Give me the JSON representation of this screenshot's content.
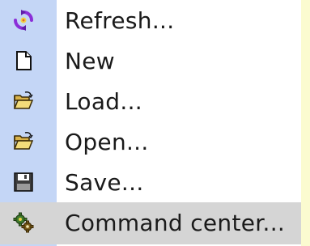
{
  "menu": {
    "items": [
      {
        "label": "Refresh...",
        "icon": "refresh-icon"
      },
      {
        "label": "New",
        "icon": "new-document-icon"
      },
      {
        "label": "Load...",
        "icon": "open-folder-icon"
      },
      {
        "label": "Open...",
        "icon": "open-folder-icon"
      },
      {
        "label": "Save...",
        "icon": "floppy-disk-icon"
      },
      {
        "label": "Command center...",
        "icon": "gears-icon",
        "highlighted": true
      }
    ]
  },
  "colors": {
    "background": "#fbfbd0",
    "gutter": "#c4d6f6",
    "menu_body": "#ffffff",
    "highlight": "#d5d5d5",
    "text": "#1a1a1a"
  }
}
